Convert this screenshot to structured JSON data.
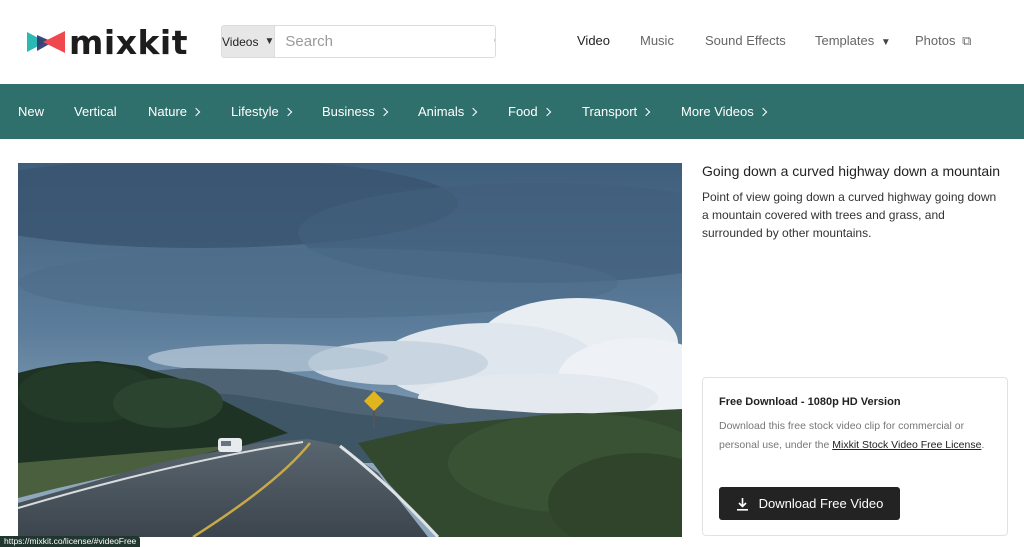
{
  "brand": {
    "name": "mixkit"
  },
  "search": {
    "type_label": "Videos",
    "placeholder": "Search",
    "value": ""
  },
  "topnav": {
    "video": "Video",
    "music": "Music",
    "sound_effects": "Sound Effects",
    "templates": "Templates",
    "photos": "Photos"
  },
  "categories": {
    "new": "New",
    "vertical": "Vertical",
    "nature": "Nature",
    "lifestyle": "Lifestyle",
    "business": "Business",
    "animals": "Animals",
    "food": "Food",
    "transport": "Transport",
    "more": "More Videos"
  },
  "video": {
    "title": "Going down a curved highway down a mountain",
    "description": "Point of view going down a curved highway going down a mountain covered with trees and grass, and surrounded by other mountains."
  },
  "download": {
    "title": "Free Download - 1080p HD Version",
    "desc_before": "Download this free stock video clip for commercial or personal use, under the ",
    "license_link": "Mixkit Stock Video Free License",
    "desc_after": ".",
    "button": "Download Free Video"
  },
  "status_url": "https://mixkit.co/license/#videoFree",
  "colors": {
    "category_bar": "#2f6f6c",
    "button": "#232323",
    "logo_red": "#f0484f",
    "logo_teal": "#2cb9b4",
    "logo_navy": "#2f3e73"
  }
}
